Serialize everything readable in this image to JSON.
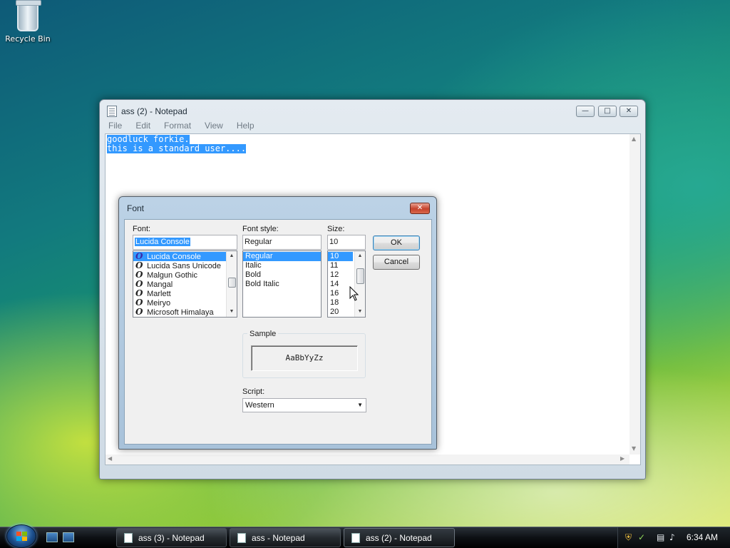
{
  "desktop": {
    "recycle_bin_label": "Recycle Bin"
  },
  "notepad": {
    "title": "ass (2) - Notepad",
    "menu": [
      "File",
      "Edit",
      "Format",
      "View",
      "Help"
    ],
    "lines": [
      "goodluck forkie.",
      "this is a standard user...."
    ]
  },
  "font_dialog": {
    "title": "Font",
    "font_label": "Font:",
    "font_value": "Lucida Console",
    "fonts": [
      "Lucida Console",
      "Lucida Sans Unicode",
      "Malgun Gothic",
      "Mangal",
      "Marlett",
      "Meiryo",
      "Microsoft Himalaya"
    ],
    "style_label": "Font style:",
    "style_value": "Regular",
    "styles": [
      "Regular",
      "Italic",
      "Bold",
      "Bold Italic"
    ],
    "size_label": "Size:",
    "size_value": "10",
    "sizes": [
      "10",
      "11",
      "12",
      "14",
      "16",
      "18",
      "20"
    ],
    "ok_label": "OK",
    "cancel_label": "Cancel",
    "sample_label": "Sample",
    "sample_text": "AaBbYyZz",
    "script_label": "Script:",
    "script_value": "Western",
    "font_icon_glyph": "O"
  },
  "taskbar": {
    "buttons": [
      "ass (3) - Notepad",
      "ass - Notepad",
      "ass (2) - Notepad"
    ],
    "active_index": 2,
    "clock": "6:34 AM"
  },
  "colors": {
    "selection": "#3399ff"
  }
}
